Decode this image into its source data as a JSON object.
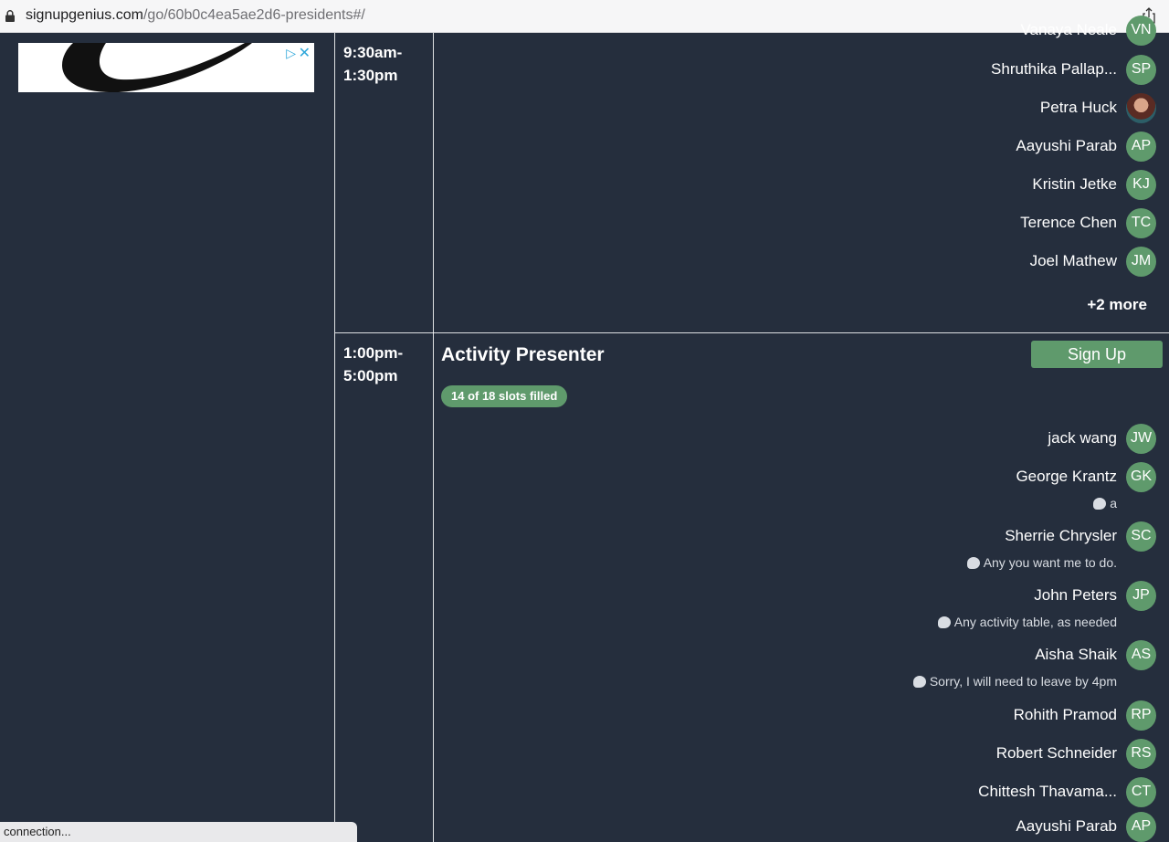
{
  "browser": {
    "url_host": "signupgenius.com",
    "url_path": "/go/60b0c4ea5ae2d6-presidents#/",
    "status_text": "connection..."
  },
  "ad": {
    "close": "✕",
    "choices": "▷"
  },
  "slot1": {
    "time_start": "9:30am-",
    "time_end": "1:30pm",
    "people": [
      {
        "name": "Vanaya Neale",
        "initials": "VN"
      },
      {
        "name": "Shruthika Pallap...",
        "initials": "SP"
      },
      {
        "name": "Petra Huck",
        "initials": ""
      },
      {
        "name": "Aayushi Parab",
        "initials": "AP"
      },
      {
        "name": "Kristin Jetke",
        "initials": "KJ"
      },
      {
        "name": "Terence Chen",
        "initials": "TC"
      },
      {
        "name": "Joel Mathew",
        "initials": "JM"
      }
    ],
    "more": "+2 more"
  },
  "slot2": {
    "time_start": "1:00pm-",
    "time_end": "5:00pm",
    "title": "Activity Presenter",
    "badge": "14 of 18 slots filled",
    "signup_label": "Sign Up",
    "people": [
      {
        "name": "jack wang",
        "initials": "JW"
      },
      {
        "name": "George Krantz",
        "initials": "GK",
        "comment": "a"
      },
      {
        "name": "Sherrie Chrysler",
        "initials": "SC",
        "comment": "Any you want me to do."
      },
      {
        "name": "John Peters",
        "initials": "JP",
        "comment": "Any activity table, as needed"
      },
      {
        "name": "Aisha Shaik",
        "initials": "AS",
        "comment": "Sorry, I will need to leave by 4pm"
      },
      {
        "name": "Rohith Pramod",
        "initials": "RP"
      },
      {
        "name": "Robert Schneider",
        "initials": "RS"
      },
      {
        "name": "Chittesh Thavama...",
        "initials": "CT"
      },
      {
        "name": "Aayushi Parab",
        "initials": "AP"
      }
    ]
  },
  "colors": {
    "background": "#252e3d",
    "accent": "#5f9a6c"
  }
}
